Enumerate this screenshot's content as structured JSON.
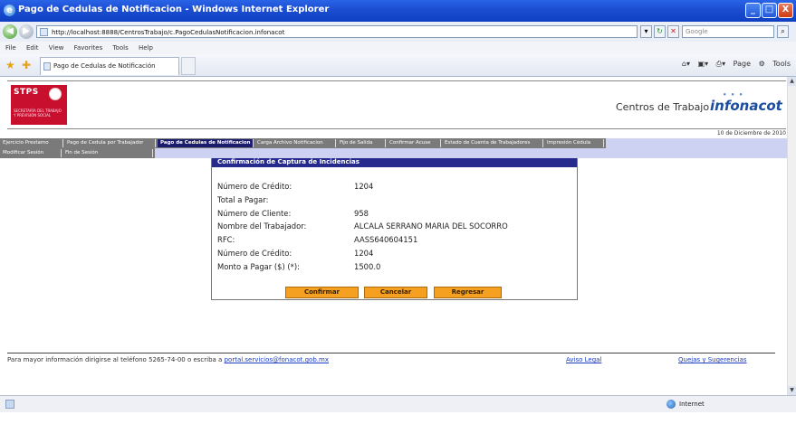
{
  "window": {
    "title": "Pago de Cedulas de Notificacion - Windows Internet Explorer",
    "controls": [
      "_",
      "□",
      "X"
    ]
  },
  "address": {
    "url": "http://localhost:8888/CentrosTrabajo/c.PagoCedulasNotificacion.infonacot",
    "search_placeholder": "Google"
  },
  "menu": [
    "File",
    "Edit",
    "View",
    "Favorites",
    "Tools",
    "Help"
  ],
  "tab": {
    "label": "Pago de Cedulas de Notificación"
  },
  "toolbar_right": [
    "Page",
    "Tools"
  ],
  "header": {
    "stps_logo": "STPS",
    "stps_text": "SECRETARÍA DEL TRABAJO Y PREVISIÓN SOCIAL",
    "centros": "Centros de Trabajo",
    "brand": "infonacot",
    "date": "10 de Diciembre de 2010"
  },
  "nav": {
    "row1": [
      "Ejercicio Prestamo",
      "Pago de Cedula por Trabajador",
      "Pago de Cedulas de Notificacion",
      "Carga Archivo Notificacion",
      "Fijo de Salida",
      "Confirmar Acuse",
      "Estado de Cuenta de Trabajadores",
      "Impresión Cédula"
    ],
    "row2": [
      "Modificar Sesión",
      "Fin de Sesión"
    ],
    "active_index": 2
  },
  "panel": {
    "title": "Confirmación de Captura de Incidencias",
    "fields": [
      {
        "label": "Número de Crédito:",
        "value": "1204"
      },
      {
        "label": "Total a Pagar:",
        "value": ""
      },
      {
        "label": "Número de Cliente:",
        "value": "958"
      },
      {
        "label": "Nombre del Trabajador:",
        "value": "ALCALA SERRANO MARIA DEL SOCORRO"
      },
      {
        "label": "RFC:",
        "value": "AASS640604151"
      },
      {
        "label": "Número de Crédito:",
        "value": "1204"
      },
      {
        "label": "Monto a Pagar ($) (*):",
        "value": "1500.0"
      }
    ],
    "buttons": {
      "confirm": "Confirmar",
      "cancel": "Cancelar",
      "back": "Regresar"
    }
  },
  "footer": {
    "text": "Para mayor información dirigirse al teléfono 5265-74-00 o escriba a",
    "email": "portal.servicios@fonacot.gob.mx",
    "aviso": "Aviso Legal",
    "quejas": "Quejas y Sugerencias"
  },
  "status": {
    "zone": "Internet"
  },
  "colors": {
    "nav_active": "#1c1c6c",
    "panel_head": "#262a8c",
    "button": "#f5a021",
    "stps_red": "#c8102e"
  }
}
